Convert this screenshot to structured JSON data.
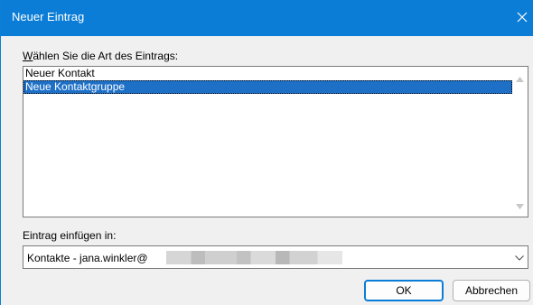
{
  "dialog": {
    "title": "Neuer Eintrag",
    "close_icon": "close-icon"
  },
  "entry_type": {
    "label_accel": "W",
    "label_rest": "ählen Sie die Art des Eintrags:",
    "items": [
      {
        "label": "Neuer Kontakt",
        "selected": false
      },
      {
        "label": "Neue Kontaktgruppe",
        "selected": true
      }
    ]
  },
  "insert_in": {
    "label": "Eintrag einfügen in:",
    "value": "Kontakte - jana.winkler@"
  },
  "buttons": {
    "ok": "OK",
    "cancel": "Abbrechen"
  },
  "colors": {
    "accent": "#0c7dd6",
    "selection": "#1e70c7",
    "background": "#f0f0f0"
  }
}
